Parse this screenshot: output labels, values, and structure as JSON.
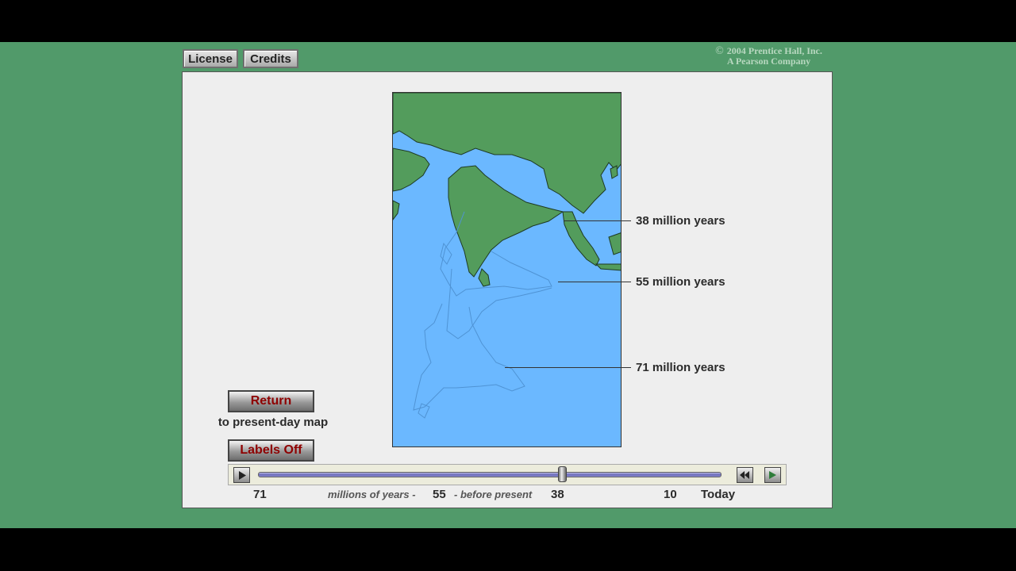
{
  "header": {
    "license_label": "License",
    "credits_label": "Credits",
    "copyright_line1": "2004 Prentice Hall, Inc.",
    "copyright_line2": "A Pearson Company",
    "copyright_symbol": "©"
  },
  "map": {
    "labels": [
      "38 million years",
      "55 million years",
      "71 million years"
    ],
    "colors": {
      "ocean": "#6bb8ff",
      "land": "#519a5a",
      "outline": "#4f93d4"
    }
  },
  "controls": {
    "return_label": "Return",
    "return_caption": "to present-day map",
    "labels_toggle": "Labels Off"
  },
  "timeline": {
    "ticks": [
      "71",
      "38",
      "10",
      "Today"
    ],
    "caption_prefix": "millions of  years -",
    "current_value": "55",
    "caption_suffix": "-  before present",
    "slider_position_fraction": 0.66,
    "buttons": {
      "play": "play-icon",
      "rewind": "rewind-icon",
      "step": "step-forward-icon"
    }
  }
}
